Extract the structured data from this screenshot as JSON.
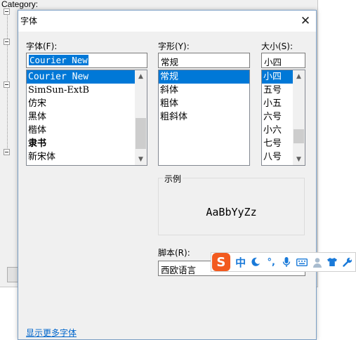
{
  "background": {
    "category_label": "Category:"
  },
  "dialog": {
    "title": "字体",
    "font": {
      "label": "字体(F):",
      "value": "Courier New",
      "items": [
        "Courier New",
        "SimSun-ExtB",
        "仿宋",
        "黑体",
        "楷体",
        "隶书",
        "新宋体"
      ],
      "selected": "Courier New"
    },
    "style": {
      "label": "字形(Y):",
      "value": "常规",
      "items": [
        "常规",
        "斜体",
        "粗体",
        "粗斜体"
      ],
      "selected": "常规"
    },
    "size": {
      "label": "大小(S):",
      "value": "小四",
      "items": [
        "小四",
        "五号",
        "小五",
        "六号",
        "小六",
        "七号",
        "八号"
      ],
      "selected": "小四"
    },
    "sample": {
      "label": "示例",
      "text": "AaBbYyZz"
    },
    "script": {
      "label": "脚本(R):",
      "value": "西欧语言"
    },
    "more_fonts_link": "显示更多字体"
  },
  "ime_toolbar": {
    "logo": "S",
    "mode": "中",
    "icons": [
      "moon-icon",
      "punctuation-icon",
      "microphone-icon",
      "keyboard-icon",
      "user-icon",
      "shirt-icon",
      "wrench-icon"
    ]
  }
}
